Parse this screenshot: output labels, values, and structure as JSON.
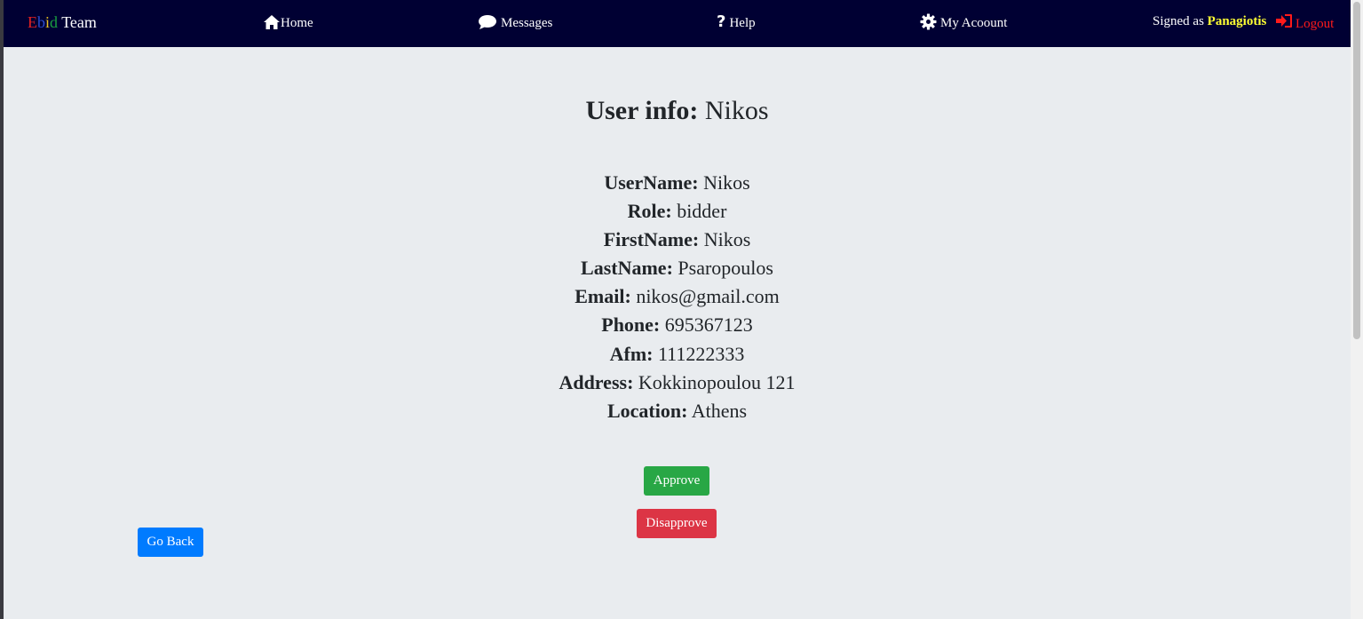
{
  "navbar": {
    "brand": {
      "letters": [
        {
          "char": "E",
          "color": "#e02020"
        },
        {
          "char": "b",
          "color": "#2a4dd0"
        },
        {
          "char": "i",
          "color": "#e8c020"
        },
        {
          "char": "d",
          "color": "#1aa040"
        }
      ],
      "suffix": " Team"
    },
    "home_label": "Home",
    "messages_label": "Messages",
    "help_label": "Help",
    "account_label": "My Acoount",
    "signed_prefix": "Signed as ",
    "signed_user": "Panagiotis",
    "logout_label": "Logout"
  },
  "page": {
    "title_label": "User info:",
    "title_value": " Nikos",
    "fields": [
      {
        "label": "UserName:",
        "value": " Nikos"
      },
      {
        "label": "Role:",
        "value": " bidder"
      },
      {
        "label": "FirstName:",
        "value": " Nikos"
      },
      {
        "label": "LastName:",
        "value": " Psaropoulos"
      },
      {
        "label": "Email:",
        "value": " nikos@gmail.com"
      },
      {
        "label": "Phone:",
        "value": " 695367123"
      },
      {
        "label": "Afm:",
        "value": " 111222333"
      },
      {
        "label": "Address:",
        "value": " Kokkinopoulou 121"
      },
      {
        "label": "Location:",
        "value": " Athens"
      }
    ],
    "approve_label": "Approve",
    "disapprove_label": "Disapprove",
    "go_back_label": "Go Back"
  },
  "icons": {
    "home": "home-icon",
    "messages": "comment-icon",
    "help": "question-icon",
    "account": "gear-icon",
    "logout": "sign-in-icon"
  },
  "colors": {
    "navbar_bg": "#000033",
    "page_bg": "#e9ecef",
    "signed_user": "#ffff33",
    "logout": "#ff1a1a",
    "approve": "#28a745",
    "disapprove": "#dc3545",
    "go_back": "#007bff"
  }
}
